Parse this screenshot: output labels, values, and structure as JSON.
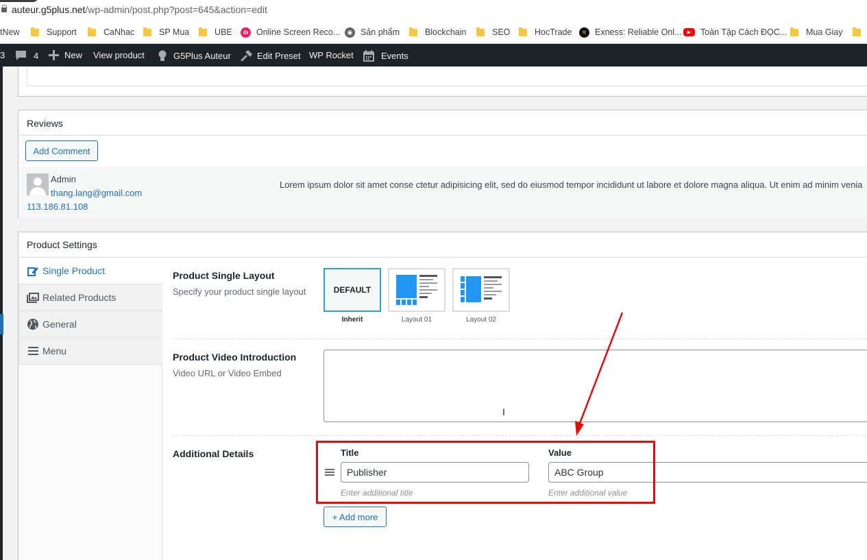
{
  "browser": {
    "url_host": "auteur.g5plus.net",
    "url_path": "/wp-admin/post.php?post=645&action=edit",
    "bookmarks": [
      {
        "label": "tNew",
        "icon": "none"
      },
      {
        "label": "Support",
        "icon": "folder-icon"
      },
      {
        "label": "CaNhac",
        "icon": "folder-icon"
      },
      {
        "label": "SP Mua",
        "icon": "folder-icon"
      },
      {
        "label": "UBE",
        "icon": "folder-icon"
      },
      {
        "label": "Online Screen Reco...",
        "icon": "screen-recorder-icon"
      },
      {
        "label": "Sản phẩm",
        "icon": "globe-icon"
      },
      {
        "label": "Blockchain",
        "icon": "folder-icon"
      },
      {
        "label": "SEO",
        "icon": "folder-icon"
      },
      {
        "label": "HocTrade",
        "icon": "folder-icon"
      },
      {
        "label": "Exness: Reliable Onl...",
        "icon": "exness-icon"
      },
      {
        "label": "Toàn Tập Cách ĐỌC...",
        "icon": "youtube-icon"
      },
      {
        "label": "Mua Giay",
        "icon": "folder-icon"
      }
    ]
  },
  "adminbar": {
    "updates_count": "3",
    "comments_count": "4",
    "new_label": "New",
    "view_product_label": "View product",
    "g5plus_label": "G5Plus Auteur",
    "edit_preset_label": "Edit Preset",
    "wp_rocket_label": "WP Rocket",
    "events_label": "Events"
  },
  "reviews": {
    "title": "Reviews",
    "add_comment_label": "Add Comment",
    "comment": {
      "author": "Admin",
      "email": "thang.lang@gmail.com",
      "ip": "113.186.81.108",
      "text": "Lorem ipsum dolor sit amet conse ctetur adipisicing elit, sed do eiusmod tempor incididunt ut labore et dolore magna aliqua. Ut enim ad minim venia"
    }
  },
  "product_settings": {
    "title": "Product Settings",
    "tabs": [
      {
        "label": "Single Product",
        "icon": "edit-icon",
        "active": true
      },
      {
        "label": "Related Products",
        "icon": "images-icon",
        "active": false
      },
      {
        "label": "General",
        "icon": "globe-icon",
        "active": false
      },
      {
        "label": "Menu",
        "icon": "menu-icon",
        "active": false
      }
    ],
    "single_layout": {
      "label": "Product Single Layout",
      "description": "Specify your product single layout",
      "default_text": "DEFAULT",
      "options": [
        "Inherit",
        "Layout 01",
        "Layout 02"
      ],
      "selected": "Inherit"
    },
    "video": {
      "label": "Product Video Introduction",
      "description": "Video URL or Video Embed",
      "value": ""
    },
    "additional_details": {
      "label": "Additional Details",
      "title_header": "Title",
      "value_header": "Value",
      "row_title": "Publisher",
      "row_value": "ABC Group",
      "title_placeholder": "Enter additional title",
      "value_placeholder": "Enter additional value",
      "add_more_label": "+ Add more"
    }
  },
  "colors": {
    "accent": "#2271b1",
    "admin_bar": "#1d2327",
    "annotation": "#e00d0d",
    "layout_blue": "#2196f3"
  }
}
